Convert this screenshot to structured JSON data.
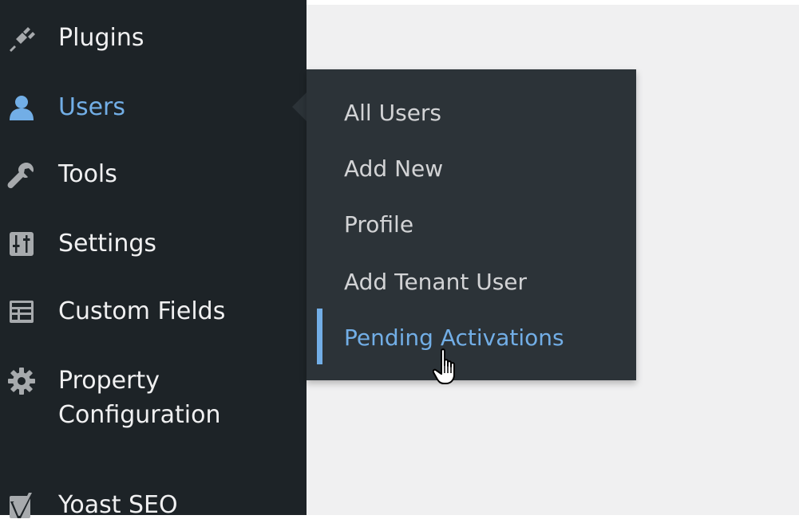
{
  "colors": {
    "sidebar_bg": "#1d2327",
    "flyout_bg": "#2c3338",
    "content_bg": "#f0f0f1",
    "text": "#f0f0f1",
    "active": "#72aee6",
    "icon": "#a7aaad"
  },
  "sidebar": {
    "items": [
      {
        "label": "Plugins",
        "icon": "plugin-icon"
      },
      {
        "label": "Users",
        "icon": "user-icon",
        "current": true
      },
      {
        "label": "Tools",
        "icon": "wrench-icon"
      },
      {
        "label": "Settings",
        "icon": "sliders-icon"
      },
      {
        "label": "Custom Fields",
        "icon": "table-icon"
      },
      {
        "label": "Property Configuration",
        "icon": "gear-icon"
      },
      {
        "label": "Yoast SEO",
        "icon": "yoast-icon"
      }
    ]
  },
  "users_submenu": {
    "items": [
      {
        "label": "All Users"
      },
      {
        "label": "Add New"
      },
      {
        "label": "Profile"
      },
      {
        "label": "Add Tenant User"
      },
      {
        "label": "Pending Activations",
        "current": true
      }
    ]
  },
  "cursor": {
    "icon": "hand-pointer-icon"
  }
}
